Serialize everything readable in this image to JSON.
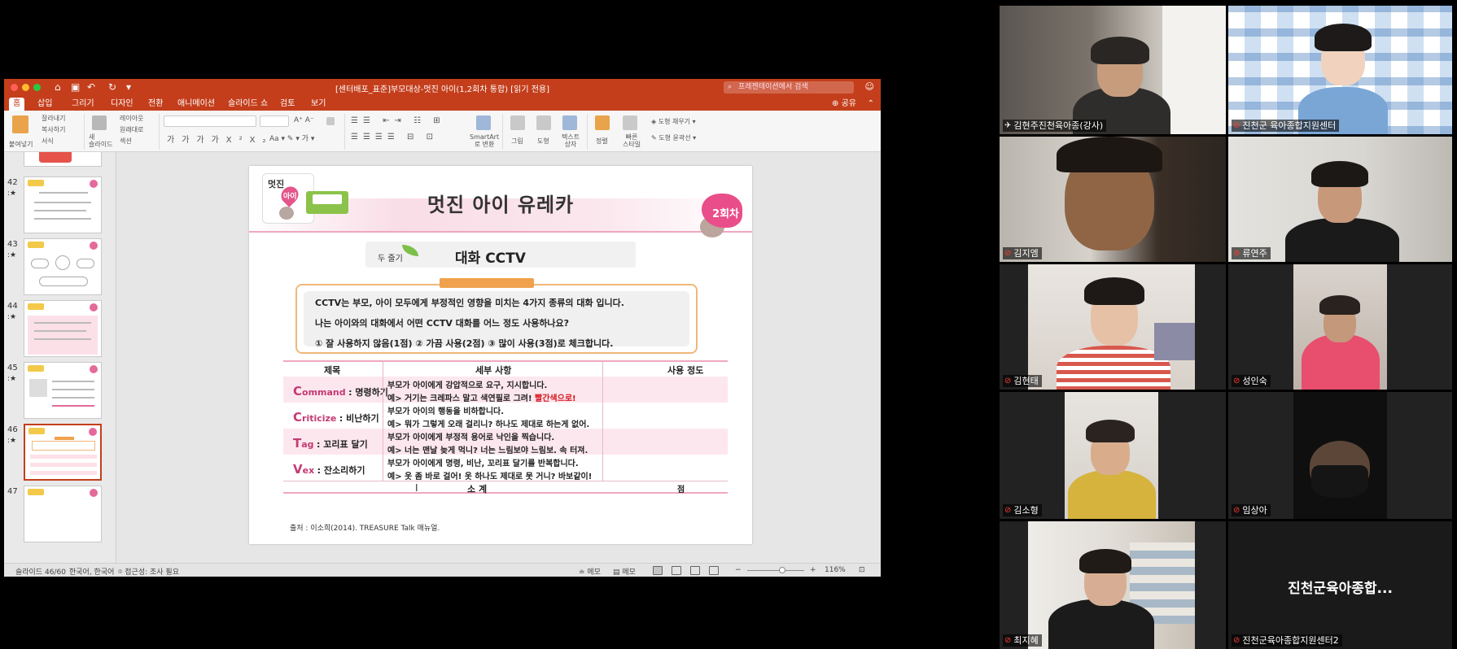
{
  "ppt": {
    "doc_title": "[센터배포_표준]부모대상-멋진 아이(1,2회차 통합) [읽기 전용]",
    "search_placeholder": "프레젠테이션에서 검색",
    "tabs": [
      {
        "label": "홈",
        "active": true
      },
      {
        "label": "삽입"
      },
      {
        "label": "그리기"
      },
      {
        "label": "디자인"
      },
      {
        "label": "전환"
      },
      {
        "label": "애니메이션"
      },
      {
        "label": "슬라이드 쇼"
      },
      {
        "label": "검토"
      },
      {
        "label": "보기"
      }
    ],
    "share_label": "공유",
    "ribbon": {
      "paste": "붙여넣기",
      "cut": "잘라내기",
      "copy": "복사하기",
      "format": "서식",
      "new_slide": "새\n슬라이드",
      "layout": "레이아웃",
      "reset": "원래대로",
      "section": "섹션",
      "smartart": "SmartArt\n로 변환",
      "picture": "그림",
      "shape": "도형",
      "textbox": "텍스트\n상자",
      "arrange": "정렬",
      "quick_style": "빠른\n스타일",
      "shape_fill": "도형 채우기",
      "shape_outline": "도형 윤곽선"
    },
    "thumbnails": [
      {
        "num": "42"
      },
      {
        "num": "43"
      },
      {
        "num": "44"
      },
      {
        "num": "45"
      },
      {
        "num": "46",
        "selected": true
      },
      {
        "num": "47"
      }
    ],
    "status": {
      "slide_count": "슬라이드 46/60",
      "language": "한국어, 한국어",
      "accessibility": "접근성: 조사 필요",
      "notes": "메모",
      "comments": "메모",
      "zoom": "116%"
    }
  },
  "slide": {
    "logo_top": "멋진",
    "logo_heart": "아이",
    "title": "멋진 아이 유레카",
    "session": "2회차",
    "sub_label": "두 줄기",
    "sub_title": "대화 CCTV",
    "intro": [
      "CCTV는 부모, 아이 모두에게 부정적인 영향을 미치는 4가지 종류의 대화 입니다.",
      "나는 아이와의 대화에서 어떤 CCTV 대화를 어느 정도 사용하나요?",
      "① 잘 사용하지 않음(1점) ② 가끔 사용(2점) ③ 많이 사용(3점)로 체크합니다."
    ],
    "table": {
      "headers": [
        "제목",
        "세부 사항",
        "사용 정도"
      ],
      "rows": [
        {
          "cap": "C",
          "rest": "ommand",
          "kr": ": 명령하기",
          "line1": "부모가 아이에게 강압적으로 요구, 지시합니다.",
          "line2": "예> 거기는 크레파스 말고 색연필로 그려! ",
          "line2_red": "빨간색으로!"
        },
        {
          "cap": "C",
          "rest": "riticize",
          "kr": ": 비난하기",
          "line1": "부모가 아이의 행동을 비하합니다.",
          "line2": "예> 뭐가 그렇게 오래 걸리니? 하나도 제대로 하는게 없어.",
          "line2_red": ""
        },
        {
          "cap": "T",
          "rest": "ag",
          "kr": ": 꼬리표 달기",
          "line1": "부모가 아이에게 부정적 용어로 낙인을 찍습니다.",
          "line2": "예> 너는 맨날 늦게 먹니? 너는 느림보야 느림보. 속 터져.",
          "line2_red": ""
        },
        {
          "cap": "V",
          "rest": "ex",
          "kr": ": 잔소리하기",
          "line1": "부모가 아이에게 명령, 비난, 꼬리표 달기를 반복합니다.",
          "line2": "예> 옷 좀 바로 걸어! 옷 하나도 제대로 못 거니? 바보같이!",
          "line2_red": ""
        }
      ],
      "total_label": "소 계",
      "total_unit": "점"
    },
    "source": "출처 : 이소희(2014). TREASURE Talk 매뉴얼."
  },
  "participants": [
    {
      "name": "김현주진천육아종(강사)",
      "speaker": true,
      "pinned": true
    },
    {
      "name": "진천군 육아종합지원센터"
    },
    {
      "name": "김지엠"
    },
    {
      "name": "류연주"
    },
    {
      "name": "김현태"
    },
    {
      "name": "성인숙"
    },
    {
      "name": "김소형"
    },
    {
      "name": "임상아"
    },
    {
      "name": "최지혜"
    },
    {
      "name": "진천군육아종합지원센터2",
      "display_text": "진천군육아종합..."
    }
  ],
  "colors": {
    "ppt_accent": "#c43e1c",
    "speaker_outline": "#d9e02a",
    "mic_off": "#ff3b30"
  }
}
